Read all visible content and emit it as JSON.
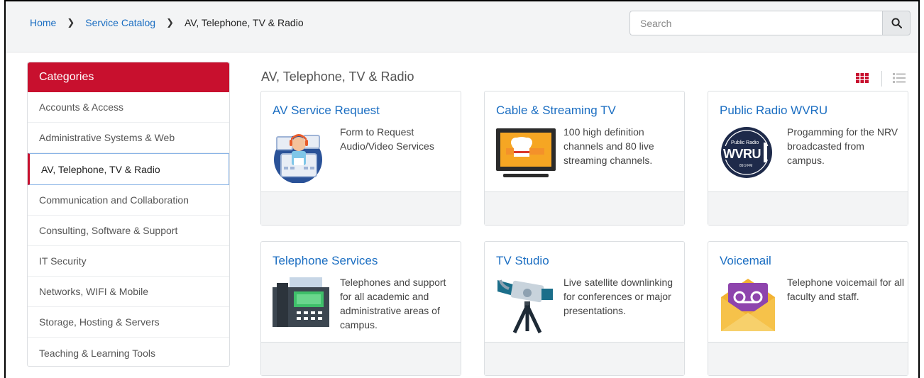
{
  "breadcrumb": {
    "home": "Home",
    "catalog": "Service Catalog",
    "current": "AV, Telephone, TV & Radio"
  },
  "search": {
    "placeholder": "Search"
  },
  "sidebar": {
    "header": "Categories",
    "items": [
      {
        "label": "Accounts & Access"
      },
      {
        "label": "Administrative Systems & Web"
      },
      {
        "label": "AV, Telephone, TV & Radio",
        "active": true
      },
      {
        "label": "Communication and Collaboration"
      },
      {
        "label": "Consulting, Software & Support"
      },
      {
        "label": "IT Security"
      },
      {
        "label": "Networks, WIFI & Mobile"
      },
      {
        "label": "Storage, Hosting & Servers"
      },
      {
        "label": "Teaching & Learning Tools"
      }
    ]
  },
  "main": {
    "title": "AV, Telephone, TV & Radio",
    "view_icons": [
      "grid-view-icon",
      "list-view-icon"
    ]
  },
  "cards": [
    {
      "title": "AV Service Request",
      "desc": "Form to Request Audio/Video Services",
      "icon": "av-technician-icon"
    },
    {
      "title": "Cable & Streaming TV",
      "desc": "100 high definition channels and 80 live streaming channels.",
      "icon": "tv-icon"
    },
    {
      "title": "Public Radio WVRU",
      "desc": "Progamming for the NRV broadcasted from campus.",
      "icon": "wvru-logo",
      "logo_text": {
        "top": "Public Radio",
        "main": "WVRU",
        "freq": "89.9 FM"
      }
    },
    {
      "title": "Telephone Services",
      "desc": "Telephones and support for all academic and administrative areas of campus.",
      "icon": "telephone-icon"
    },
    {
      "title": "TV Studio",
      "desc": "Live satellite downlinking for conferences or major presentations.",
      "icon": "video-camera-icon"
    },
    {
      "title": "Voicemail",
      "desc": "Telephone voicemail for all faculty and staff.",
      "icon": "voicemail-icon"
    }
  ],
  "colors": {
    "accent_red": "#c8102e",
    "link_blue": "#1b6ec2",
    "topbar_bg": "#f3f4f5"
  }
}
